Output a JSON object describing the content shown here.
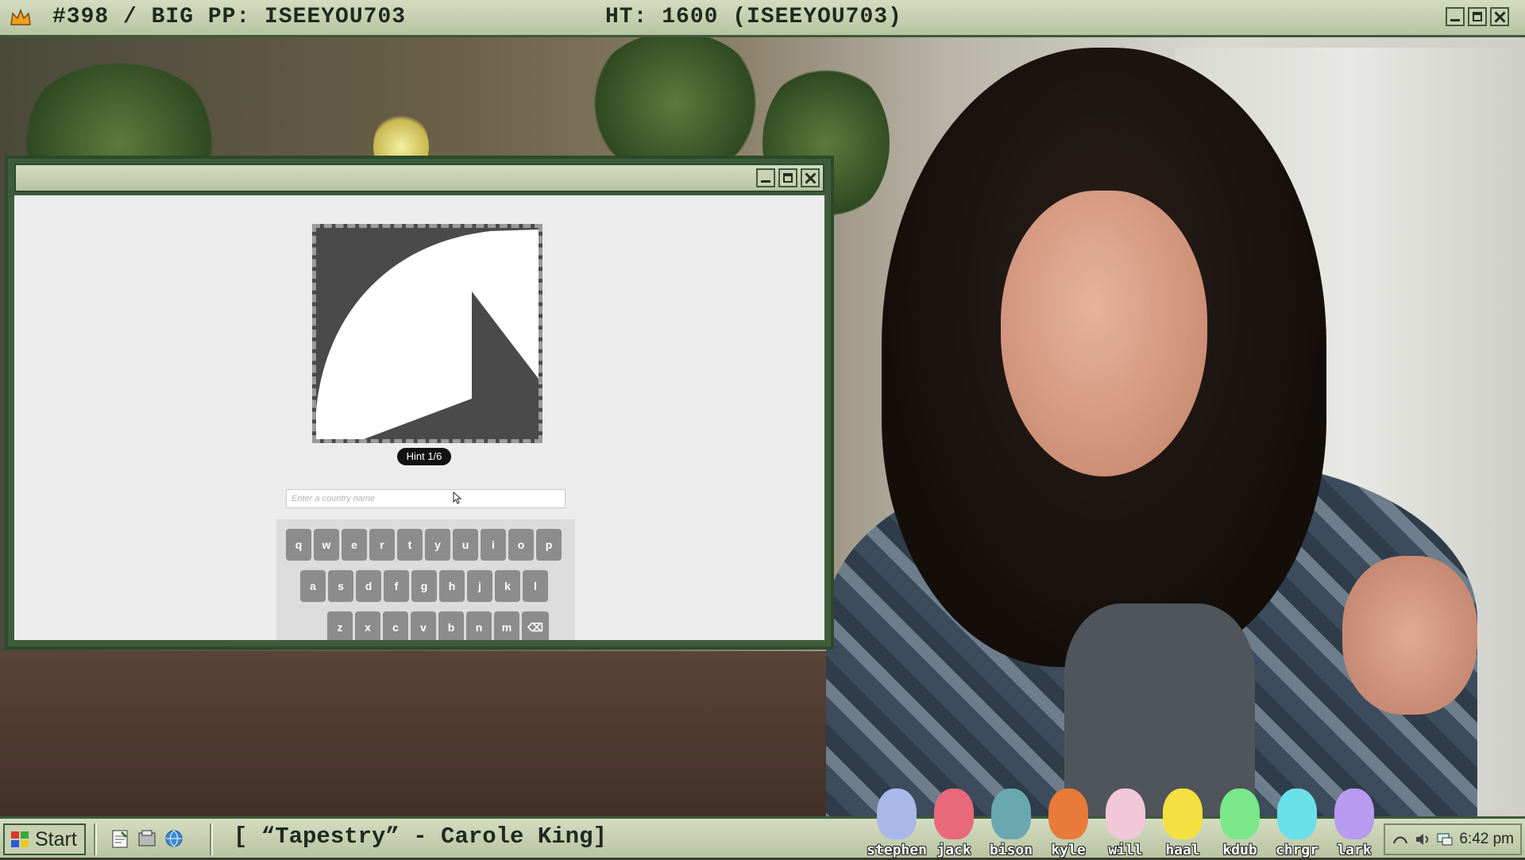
{
  "top_bar": {
    "left_text": "#398 / BIG PP: ISEEYOU703",
    "center_text": "HT: 1600 (ISEEYOU703)"
  },
  "game_window": {
    "hint_label": "Hint 1/6",
    "input_placeholder": "Enter a country name",
    "keyboard": {
      "row1": [
        "q",
        "w",
        "e",
        "r",
        "t",
        "y",
        "u",
        "i",
        "o",
        "p"
      ],
      "row2": [
        "a",
        "s",
        "d",
        "f",
        "g",
        "h",
        "j",
        "k",
        "l"
      ],
      "row3": [
        "z",
        "x",
        "c",
        "v",
        "b",
        "n",
        "m",
        "⌫"
      ]
    },
    "colors": {
      "silhouette_bg": "#4a4a4a",
      "silhouette_fg": "#ffffff",
      "frame": "#3e5c3b"
    }
  },
  "taskbar": {
    "start_label": "Start",
    "now_playing": "[ “Tapestry” - Carole King]",
    "quick_launch_icons": [
      "notepad-icon",
      "tools-icon",
      "browser-icon"
    ],
    "peeps": [
      {
        "name": "stephen",
        "color": "#a8b8e8"
      },
      {
        "name": "jack",
        "color": "#e86a7a"
      },
      {
        "name": "bison",
        "color": "#6aa8b0"
      },
      {
        "name": "kyle",
        "color": "#e87a3a"
      },
      {
        "name": "will",
        "color": "#f0c8d8"
      },
      {
        "name": "haal",
        "color": "#f4e040"
      },
      {
        "name": "kdub",
        "color": "#7ae88a"
      },
      {
        "name": "chrgr",
        "color": "#6ae0e8"
      },
      {
        "name": "lark",
        "color": "#b89af0"
      }
    ],
    "tray_icons": [
      "network-icon",
      "volume-icon",
      "display-icon"
    ],
    "clock": "6:42 pm"
  }
}
